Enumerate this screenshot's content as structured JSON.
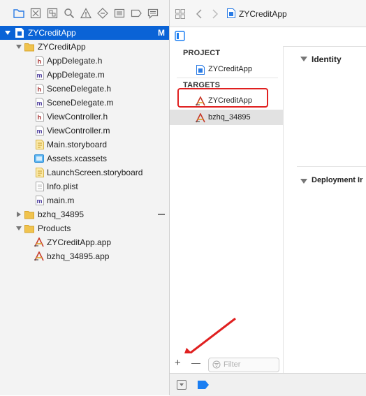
{
  "navigator": {
    "toolbar_icons": [
      "folder-icon",
      "source-control-icon",
      "symbol-icon",
      "search-icon",
      "warning-icon",
      "test-icon",
      "debug-icon",
      "breakpoint-icon",
      "report-icon"
    ],
    "items": [
      {
        "label": "ZYCreditApp",
        "type": "project",
        "badge": "M"
      },
      {
        "label": "ZYCreditApp",
        "type": "folder"
      },
      {
        "label": "AppDelegate.h",
        "type": "h"
      },
      {
        "label": "AppDelegate.m",
        "type": "m"
      },
      {
        "label": "SceneDelegate.h",
        "type": "h"
      },
      {
        "label": "SceneDelegate.m",
        "type": "m"
      },
      {
        "label": "ViewController.h",
        "type": "h"
      },
      {
        "label": "ViewController.m",
        "type": "m"
      },
      {
        "label": "Main.storyboard",
        "type": "storyboard"
      },
      {
        "label": "Assets.xcassets",
        "type": "assets"
      },
      {
        "label": "LaunchScreen.storyboard",
        "type": "storyboard"
      },
      {
        "label": "Info.plist",
        "type": "plist"
      },
      {
        "label": "main.m",
        "type": "m"
      },
      {
        "label": "bzhq_34895",
        "type": "folder"
      },
      {
        "label": "Products",
        "type": "folder"
      },
      {
        "label": "ZYCreditApp.app",
        "type": "app"
      },
      {
        "label": "bzhq_34895.app",
        "type": "app"
      }
    ]
  },
  "editor": {
    "breadcrumb": "ZYCreditApp",
    "project_header": "PROJECT",
    "project_item": "ZYCreditApp",
    "targets_header": "TARGETS",
    "targets": [
      "ZYCreditApp",
      "bzhq_34895"
    ],
    "add_label": "+",
    "remove_label": "—",
    "filter_placeholder": "Filter",
    "identity_label": "Identity",
    "deployment_label": "Deployment Ir"
  },
  "colors": {
    "selection": "#0a63d6",
    "annotation_red": "#e02020",
    "accent_blue": "#1a7ef2"
  }
}
